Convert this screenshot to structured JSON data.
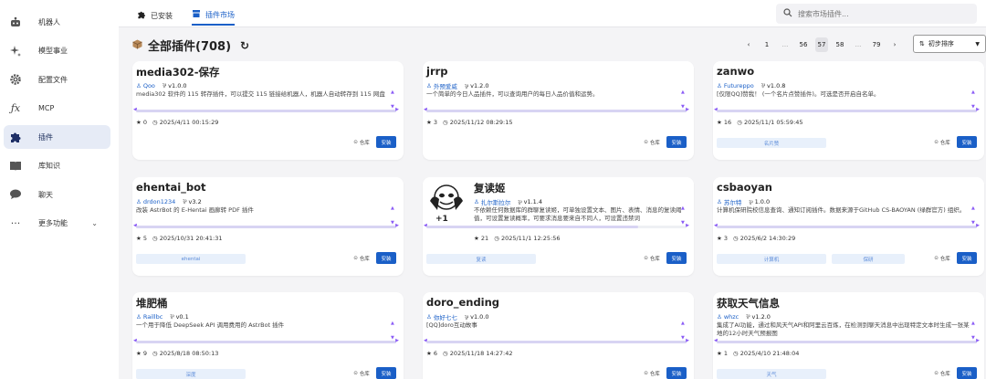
{
  "sidebar": {
    "items": [
      {
        "label": "机器人",
        "icon": "robot-icon"
      },
      {
        "label": "模型事业",
        "icon": "sparkle-icon"
      },
      {
        "label": "配置文件",
        "icon": "gear-icon"
      },
      {
        "label": "MCP",
        "icon": "function-icon"
      },
      {
        "label": "插件",
        "icon": "puzzle-icon"
      },
      {
        "label": "库知识",
        "icon": "book-icon"
      },
      {
        "label": "聊天",
        "icon": "chat-icon"
      },
      {
        "label": "更多功能",
        "icon": "more-icon"
      }
    ]
  },
  "topbar": {
    "tabs": [
      {
        "label": "已安装",
        "icon": "puzzle-icon"
      },
      {
        "label": "插件市场",
        "icon": "store-icon"
      }
    ],
    "search_placeholder": "搜索市场插件..."
  },
  "header": {
    "title": "全部插件(708)",
    "pager": {
      "prev": "‹",
      "next": "›",
      "pages": [
        "1",
        "...",
        "56",
        "57",
        "58",
        "...",
        "79"
      ]
    },
    "sort_label": "初步排序"
  },
  "cards": [
    {
      "name": "media302-保存",
      "author": "Qoo",
      "version": "v1.0.0",
      "desc": "media302 软件的 115 转存插件，可以提交 115 链接给机器人，机器人自动转存到 115 网盘",
      "stars": "0",
      "date": "2025/4/11 00:15:29",
      "tags": []
    },
    {
      "name": "jrrp",
      "author": "外预爱威",
      "version": "v1.2.0",
      "desc": "一个简单的今日人品插件，可以查询用户的每日人品价值和运势。",
      "stars": "3",
      "date": "2025/11/12 08:29:15",
      "tags": []
    },
    {
      "name": "zanwo",
      "author": "Futureppo",
      "version": "v1.0.8",
      "desc": "[仅限QQ]赞我！ (一个名片点赞插件)。可选是否开启自名单。",
      "stars": "16",
      "date": "2025/11/1 05:59:45",
      "tags": [
        "名片赞"
      ]
    },
    {
      "name": "ehentai_bot",
      "author": "drdon1234",
      "version": "v3.2",
      "desc": "改装 AstrBot 的 E-Hentai 画廊转 PDF 插件",
      "stars": "5",
      "date": "2025/10/31 20:41:31",
      "tags": [
        "ehentai"
      ]
    },
    {
      "name": "复读姬",
      "author": "扎尔斯拉尔",
      "version": "v1.1.4",
      "desc": "不依赖任何数据库的群聊复读姬，可单独设置文本、图片、表情、消息的复读阈值，可设置复读概率，可要求消息要来自不同人，可设置违禁词",
      "stars": "21",
      "date": "2025/11/1 12:25:56",
      "tags": [
        "复读"
      ]
    },
    {
      "name": "csbaoyan",
      "author": "苏尔特",
      "version": "1.0.0",
      "desc": "计算机保研院校信息查询、通知订阅插件。数据来源于GitHub CS-BAOYAN (绿群官方) 组织。",
      "stars": "3",
      "date": "2025/6/2 14:30:29",
      "tags": [
        "计算机",
        "保研"
      ]
    },
    {
      "name": "堆肥桶",
      "author": "Raillbc",
      "version": "v0.1",
      "desc": "一个用于降低 DeepSeek API 调用费用的 AstrBot 插件",
      "stars": "9",
      "date": "2025/8/18 08:50:13",
      "tags": [
        "深度"
      ]
    },
    {
      "name": "doro_ending",
      "author": "你好七七",
      "version": "v1.0.0",
      "desc": "[QQ]doro互动故事",
      "stars": "6",
      "date": "2025/11/18 14:27:42",
      "tags": []
    },
    {
      "name": "获取天气信息",
      "author": "whzc",
      "version": "v1.2.0",
      "desc": "集成了AI功能，通过和风天气API和阿里云百炼，在检测到聊天消息中出现特定文本时生成一张某地的12小时天气预报图",
      "stars": "1",
      "date": "2025/4/10 21:48:04",
      "tags": [
        "天气"
      ]
    }
  ],
  "labels": {
    "repo": "仓库",
    "install": "安装",
    "star_prefix": "★",
    "clock": "◷",
    "user": "♙",
    "tag": "🏷"
  },
  "colors": {
    "accent": "#1a5fc7",
    "sidebar_active": "#e6ebf6",
    "scroll_arrow": "#8b5cf6"
  }
}
